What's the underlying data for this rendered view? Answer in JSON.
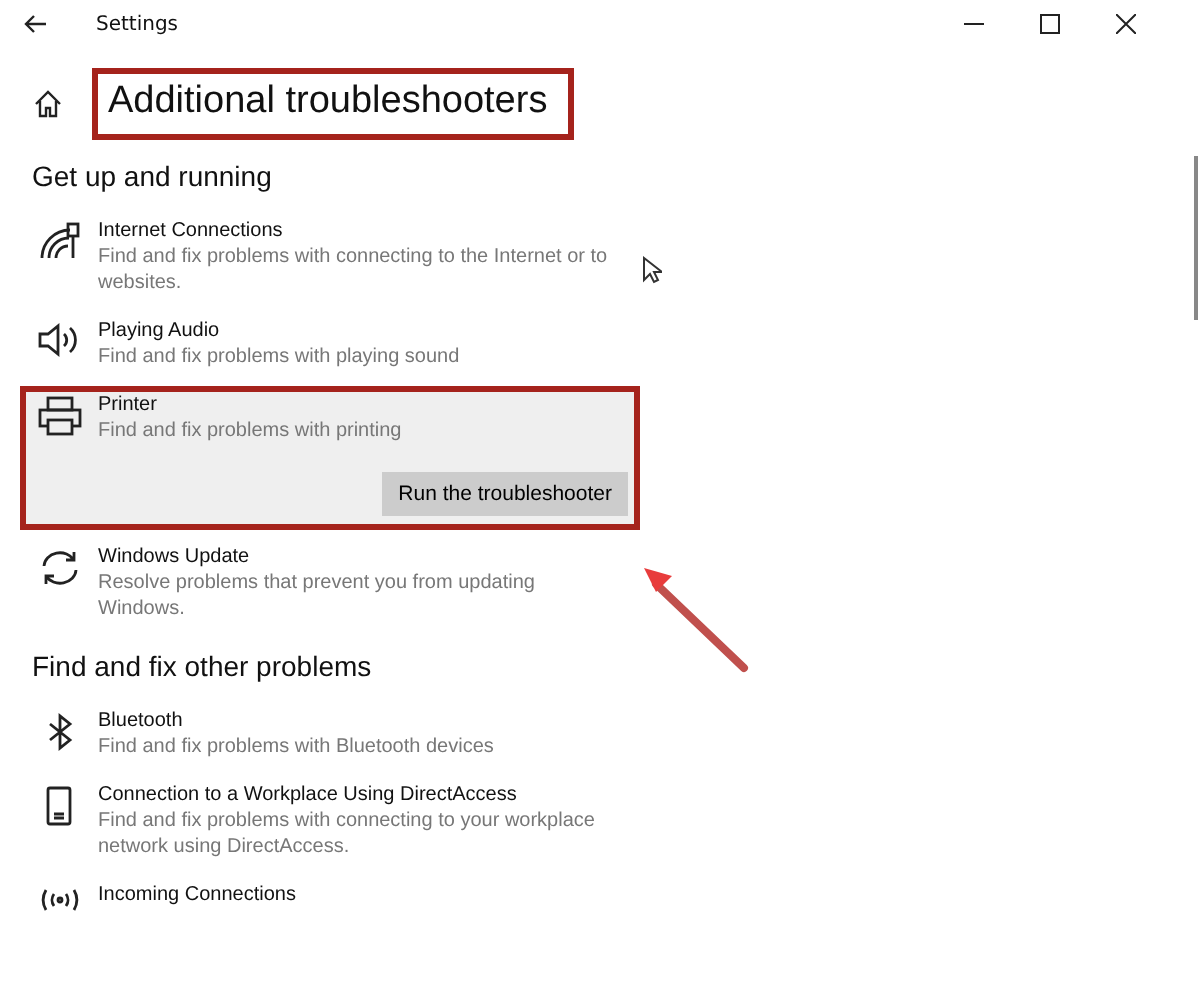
{
  "window": {
    "title": "Settings"
  },
  "page": {
    "title": "Additional troubleshooters",
    "highlighted": true
  },
  "sections": [
    {
      "heading": "Get up and running",
      "items": [
        {
          "kind": "wifi",
          "title": "Internet Connections",
          "description": "Find and fix problems with connecting to the Internet or to websites.",
          "selected": false
        },
        {
          "kind": "speaker",
          "title": "Playing Audio",
          "description": "Find and fix problems with playing sound",
          "selected": false
        },
        {
          "kind": "printer",
          "title": "Printer",
          "description": "Find and fix problems with printing",
          "selected": true,
          "highlighted": true,
          "button": "Run the troubleshooter"
        },
        {
          "kind": "sync",
          "title": "Windows Update",
          "description": "Resolve problems that prevent you from updating Windows.",
          "selected": false
        }
      ]
    },
    {
      "heading": "Find and fix other problems",
      "items": [
        {
          "kind": "bluetooth",
          "title": "Bluetooth",
          "description": "Find and fix problems with Bluetooth devices",
          "selected": false
        },
        {
          "kind": "phone",
          "title": "Connection to a Workplace Using DirectAccess",
          "description": "Find and fix problems with connecting to your workplace network using DirectAccess.",
          "selected": false
        },
        {
          "kind": "antenna",
          "title": "Incoming Connections",
          "selected": false
        }
      ]
    }
  ]
}
